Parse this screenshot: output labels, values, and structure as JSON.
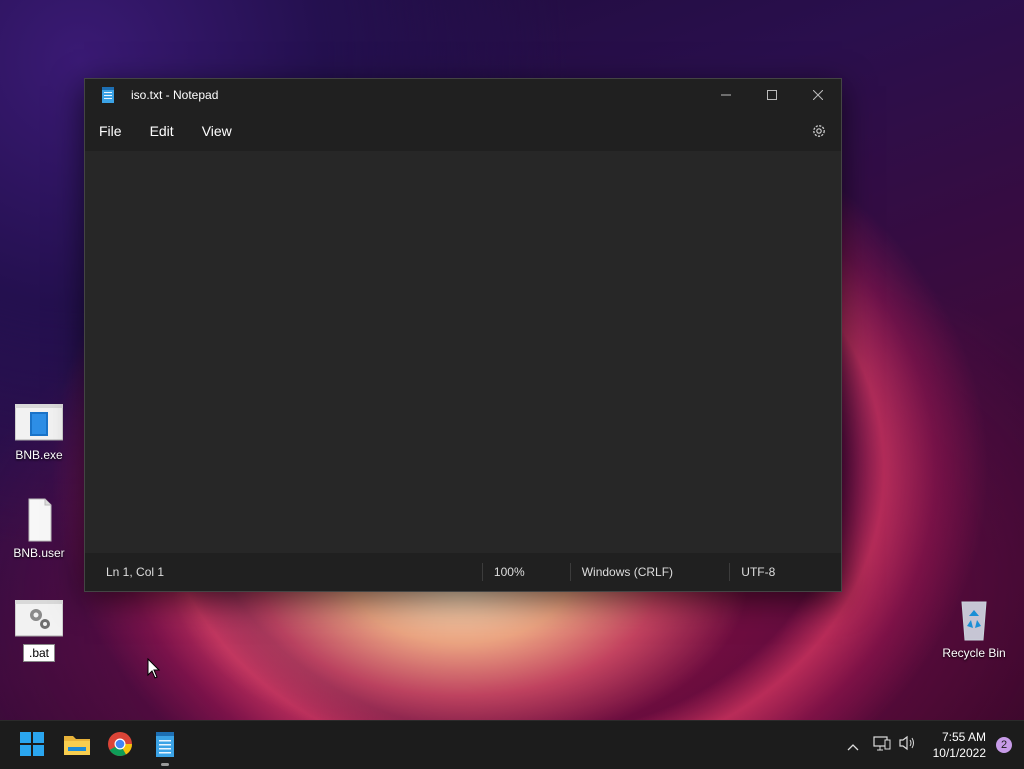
{
  "desktop": {
    "icons": [
      {
        "label": "BNB.exe"
      },
      {
        "label": "BNB.user"
      },
      {
        "label": ".bat"
      },
      {
        "label": "Recycle Bin"
      }
    ]
  },
  "notepad": {
    "title": "iso.txt - Notepad",
    "menu": [
      "File",
      "Edit",
      "View"
    ],
    "content": "",
    "status": {
      "position": "Ln 1, Col 1",
      "zoom": "100%",
      "line_ending": "Windows (CRLF)",
      "encoding": "UTF-8"
    }
  },
  "taskbar": {
    "apps": [
      "start-icon",
      "file-explorer-icon",
      "chrome-icon",
      "notepad-icon"
    ],
    "clock": {
      "time": "7:55 AM",
      "date": "10/1/2022"
    },
    "notification_count": "2"
  },
  "colors": {
    "window_bg": "#272727",
    "titlebar_bg": "#202020",
    "taskbar_bg": "#1c1c1c",
    "accent": "#0078d4"
  }
}
